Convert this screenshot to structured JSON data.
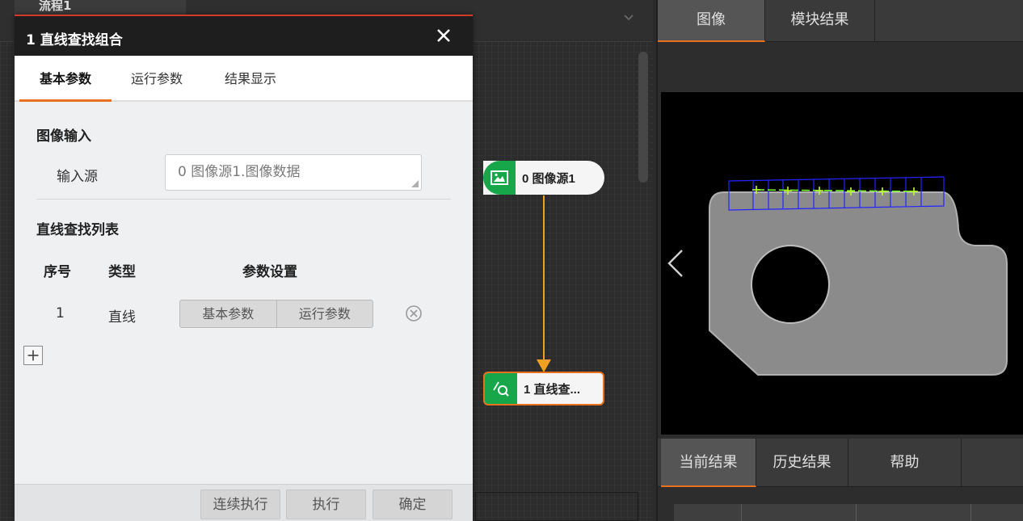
{
  "workspace": {
    "tab_label": "流程1"
  },
  "flow": {
    "node0_label": "0 图像源1",
    "node1_label": "1 直线查..."
  },
  "dialog": {
    "title": "1 直线查找组合",
    "tabs": [
      "基本参数",
      "运行参数",
      "结果显示"
    ],
    "active_tab": "基本参数",
    "image_input_section": "图像输入",
    "input_source_label": "输入源",
    "input_source_value": "0 图像源1.图像数据",
    "line_list_section": "直线查找列表",
    "table_headers": [
      "序号",
      "类型",
      "参数设置"
    ],
    "rows": [
      {
        "no": "1",
        "type": "直线",
        "param_buttons": [
          "基本参数",
          "运行参数"
        ]
      }
    ],
    "footer_buttons": [
      "连续执行",
      "执行",
      "确定"
    ]
  },
  "right_panel": {
    "top_tabs": [
      "图像",
      "模块结果"
    ],
    "active_top_tab": "图像",
    "bottom_tabs": [
      "当前结果",
      "历史结果",
      "帮助"
    ],
    "active_bottom_tab": "当前结果"
  },
  "colors": {
    "accent": "#e8711f",
    "node_green": "#18a64a",
    "title_bar": "#1e1e1e",
    "detect_box": "#2424ff",
    "detect_line": "#7cff2a"
  },
  "icons": [
    "close-icon",
    "image-icon",
    "find-line-icon",
    "remove-row-icon",
    "add-row-icon",
    "chevron-left-icon",
    "chevron-down-icon"
  ]
}
